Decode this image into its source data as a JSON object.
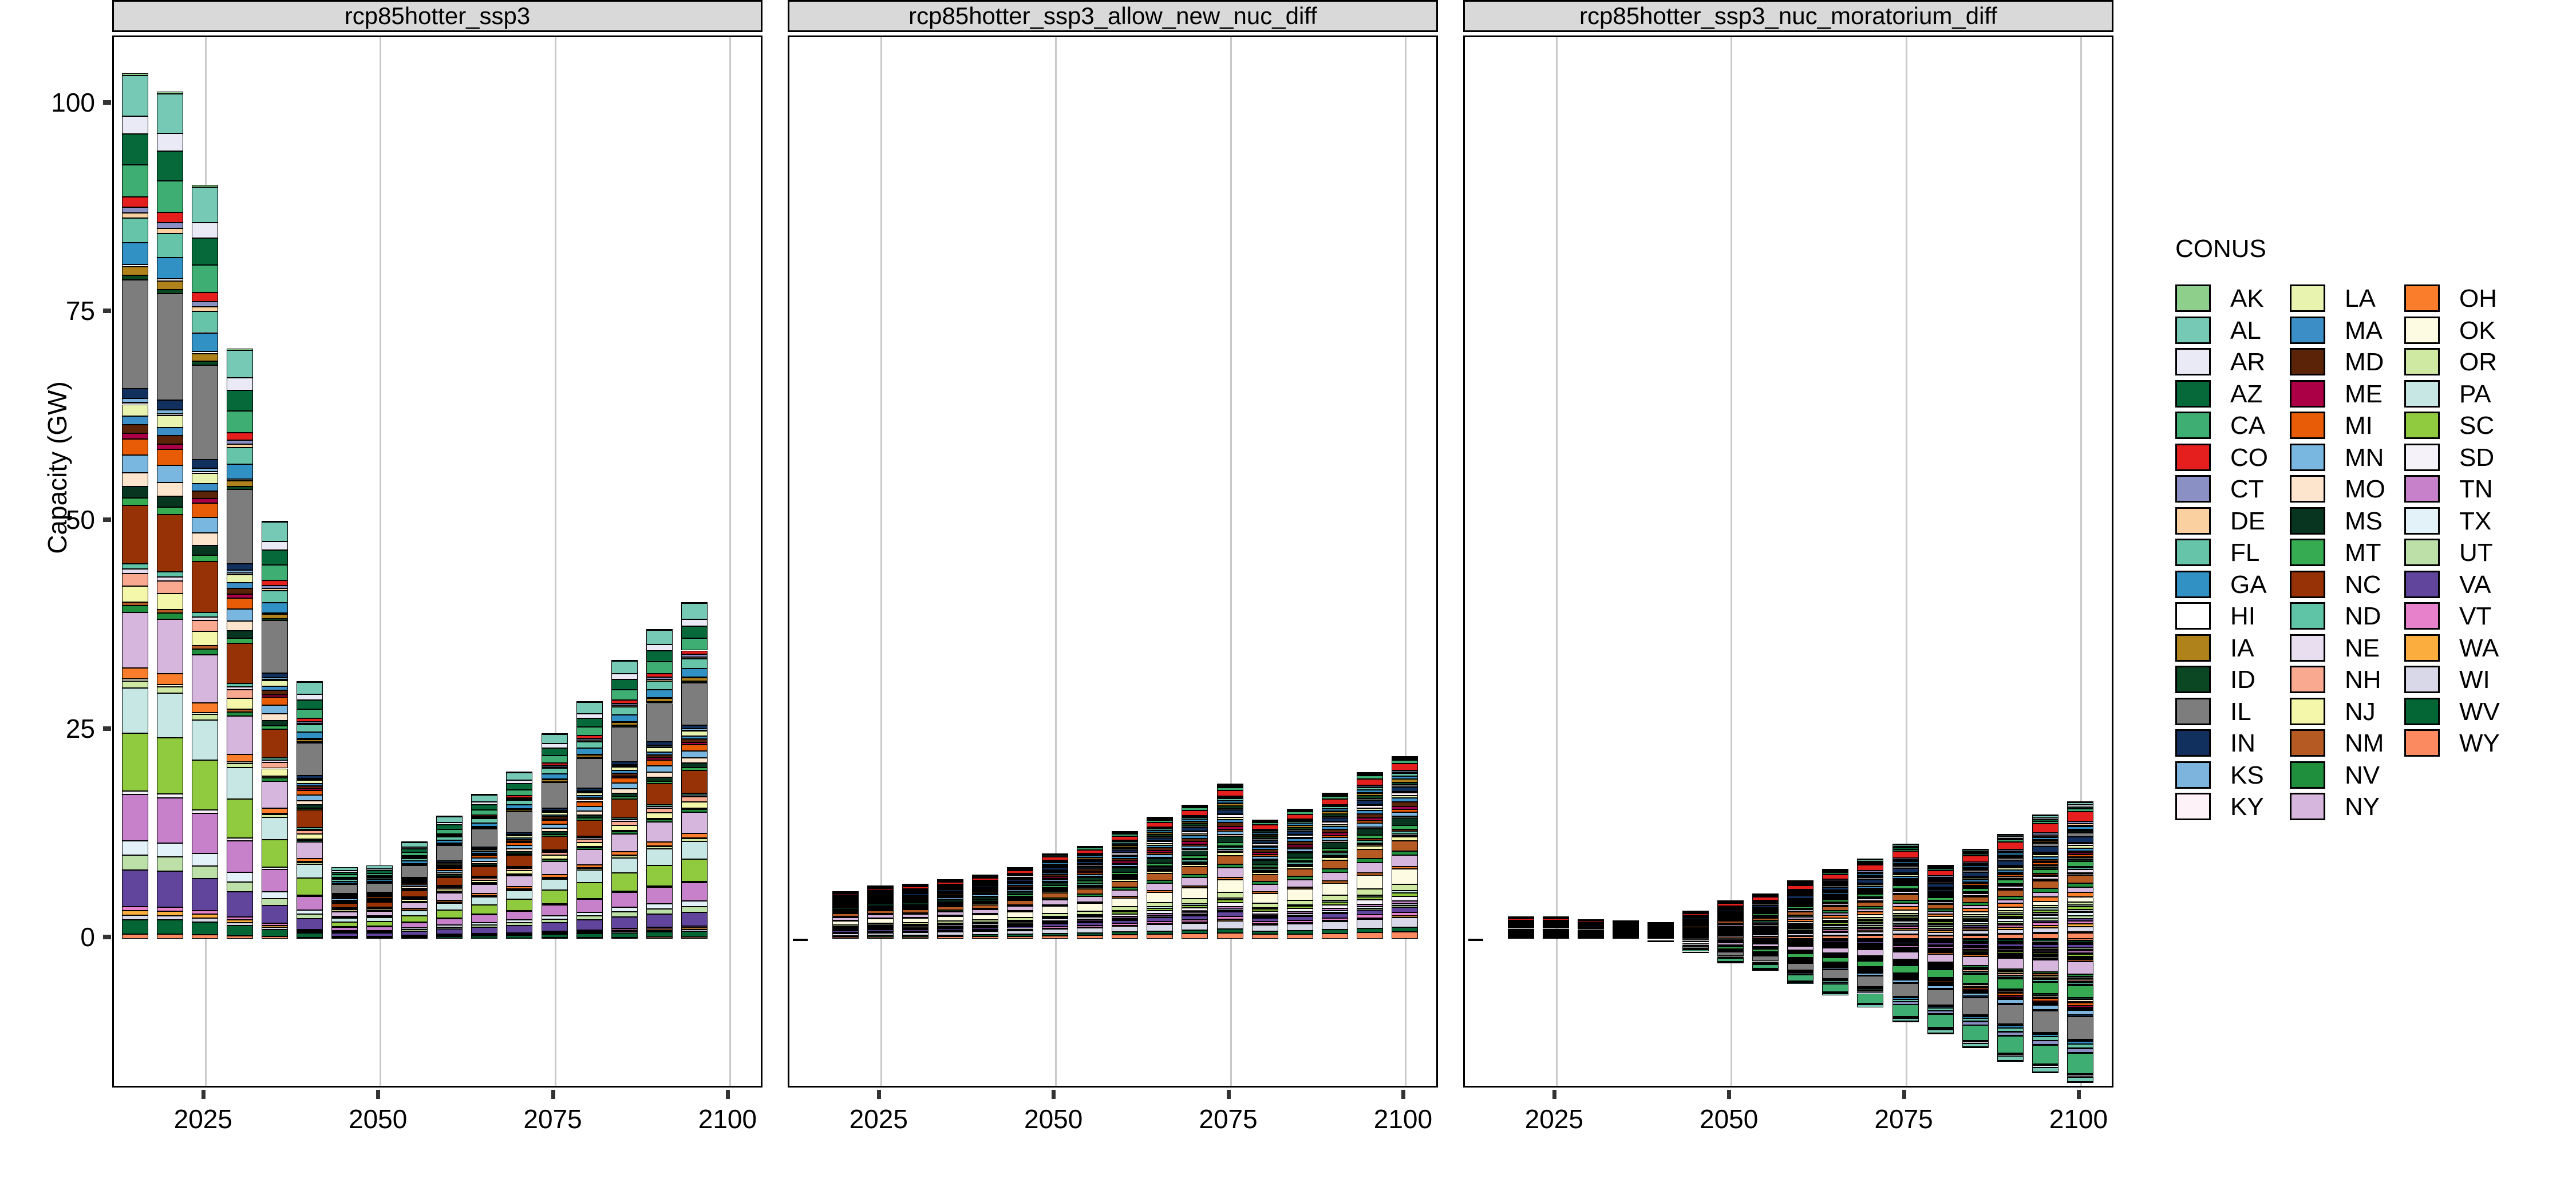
{
  "axis": {
    "ylabel": "Capacity (GW)",
    "yticks": [
      0,
      25,
      50,
      75,
      100
    ],
    "ytick_labels": [
      "0",
      "25",
      "50",
      "75",
      "100"
    ],
    "ylim": [
      -18,
      108
    ],
    "xticks": [
      2025,
      2050,
      2075,
      2100
    ],
    "xtick_labels": [
      "2025",
      "2050",
      "2075",
      "2100"
    ],
    "xlim": [
      2012,
      2105
    ]
  },
  "legend": {
    "title": "CONUS",
    "columns": [
      [
        {
          "label": "AK",
          "color": "#8ecf8c"
        },
        {
          "label": "AL",
          "color": "#76c9b5"
        },
        {
          "label": "AR",
          "color": "#eaeaf7"
        },
        {
          "label": "AZ",
          "color": "#06693a"
        },
        {
          "label": "CA",
          "color": "#3eae73"
        },
        {
          "label": "CO",
          "color": "#e51e1e"
        },
        {
          "label": "CT",
          "color": "#8a8fc4"
        },
        {
          "label": "DE",
          "color": "#fad0a0"
        },
        {
          "label": "FL",
          "color": "#66c5a8"
        },
        {
          "label": "GA",
          "color": "#3190c4"
        },
        {
          "label": "HI",
          "color": "#ffffff"
        },
        {
          "label": "IA",
          "color": "#b0821b"
        },
        {
          "label": "ID",
          "color": "#0b4722"
        },
        {
          "label": "IL",
          "color": "#7d7d7d"
        },
        {
          "label": "IN",
          "color": "#12305e"
        },
        {
          "label": "KS",
          "color": "#7cb4dd"
        },
        {
          "label": "KY",
          "color": "#fdf2f8"
        }
      ],
      [
        {
          "label": "LA",
          "color": "#e8f3b0"
        },
        {
          "label": "MA",
          "color": "#3c8fc6"
        },
        {
          "label": "MD",
          "color": "#5b2408"
        },
        {
          "label": "ME",
          "color": "#ac0046"
        },
        {
          "label": "MI",
          "color": "#e85b07"
        },
        {
          "label": "MN",
          "color": "#79b7e0"
        },
        {
          "label": "MO",
          "color": "#fde4cc"
        },
        {
          "label": "MS",
          "color": "#07351f"
        },
        {
          "label": "MT",
          "color": "#36ab52"
        },
        {
          "label": "NC",
          "color": "#973106"
        },
        {
          "label": "ND",
          "color": "#5fc3a6"
        },
        {
          "label": "NE",
          "color": "#e8def0"
        },
        {
          "label": "NH",
          "color": "#faa991"
        },
        {
          "label": "NJ",
          "color": "#f4f6a9"
        },
        {
          "label": "NM",
          "color": "#b55a23"
        },
        {
          "label": "NV",
          "color": "#1f8f3e"
        },
        {
          "label": "NY",
          "color": "#d6b6dd"
        }
      ],
      [
        {
          "label": "OH",
          "color": "#f97d2a"
        },
        {
          "label": "OK",
          "color": "#fdfbe2"
        },
        {
          "label": "OR",
          "color": "#cfe8a2"
        },
        {
          "label": "PA",
          "color": "#c6e7e4"
        },
        {
          "label": "SC",
          "color": "#90ca3e"
        },
        {
          "label": "SD",
          "color": "#f6f2fa"
        },
        {
          "label": "TN",
          "color": "#c780ca"
        },
        {
          "label": "TX",
          "color": "#e3f2f9"
        },
        {
          "label": "UT",
          "color": "#bde0a8"
        },
        {
          "label": "VA",
          "color": "#61459c"
        },
        {
          "label": "VT",
          "color": "#e881cb"
        },
        {
          "label": "WA",
          "color": "#fbae3e"
        },
        {
          "label": "WI",
          "color": "#d8d8e8"
        },
        {
          "label": "WV",
          "color": "#046634"
        },
        {
          "label": "WY",
          "color": "#fb8a60"
        }
      ]
    ]
  },
  "chart_data": {
    "type": "bar",
    "subtype": "stacked-bar-faceted",
    "title": "",
    "xlabel": "",
    "ylabel": "Capacity (GW)",
    "ylim": [
      -18,
      108
    ],
    "grid": "vertical-only",
    "legend_position": "right",
    "legend_title": "CONUS",
    "x": [
      2015,
      2020,
      2025,
      2030,
      2035,
      2040,
      2045,
      2050,
      2055,
      2060,
      2065,
      2070,
      2075,
      2080,
      2085,
      2090,
      2095,
      2100
    ],
    "facets": [
      {
        "name": "rcp85hotter_ssp3",
        "totals": [
          103.7,
          101.5,
          90.3,
          70.7,
          50.1,
          30.8,
          8.6,
          8.8,
          11.6,
          14.7,
          17.3,
          20.0,
          24.6,
          28.4,
          33.4,
          37.1,
          40.3
        ],
        "totals_x": [
          2015,
          2020,
          2025,
          2030,
          2035,
          2040,
          2045,
          2050,
          2055,
          2060,
          2065,
          2070,
          2075,
          2080,
          2085,
          2090,
          2095
        ]
      },
      {
        "name": "rcp85hotter_ssp3_allow_new_nuc_diff",
        "totals": [
          0.0,
          5.6,
          6.3,
          6.5,
          7.1,
          7.6,
          8.5,
          10.2,
          11.1,
          12.8,
          14.5,
          16.0,
          18.5,
          14.2,
          15.5,
          17.4,
          19.9,
          21.8
        ]
      },
      {
        "name": "rcp85hotter_ssp3_nuc_moratorium_diff",
        "totals_positive": [
          0.0,
          2.6,
          2.6,
          2.3,
          2.1,
          1.9,
          3.3,
          4.6,
          5.4,
          6.9,
          8.3,
          9.5,
          11.3,
          8.8,
          10.7,
          12.5,
          14.8,
          16.4
        ],
        "totals_negative": [
          0.0,
          0.0,
          0.0,
          0.0,
          0.0,
          -0.3,
          -1.6,
          -2.9,
          -3.8,
          -5.4,
          -6.8,
          -8.2,
          -9.9,
          -11.3,
          -13.0,
          -14.6,
          -16.0,
          -17.2
        ]
      }
    ]
  },
  "facet_titles": [
    "rcp85hotter_ssp3",
    "rcp85hotter_ssp3_allow_new_nuc_diff",
    "rcp85hotter_ssp3_nuc_moratorium_diff"
  ]
}
